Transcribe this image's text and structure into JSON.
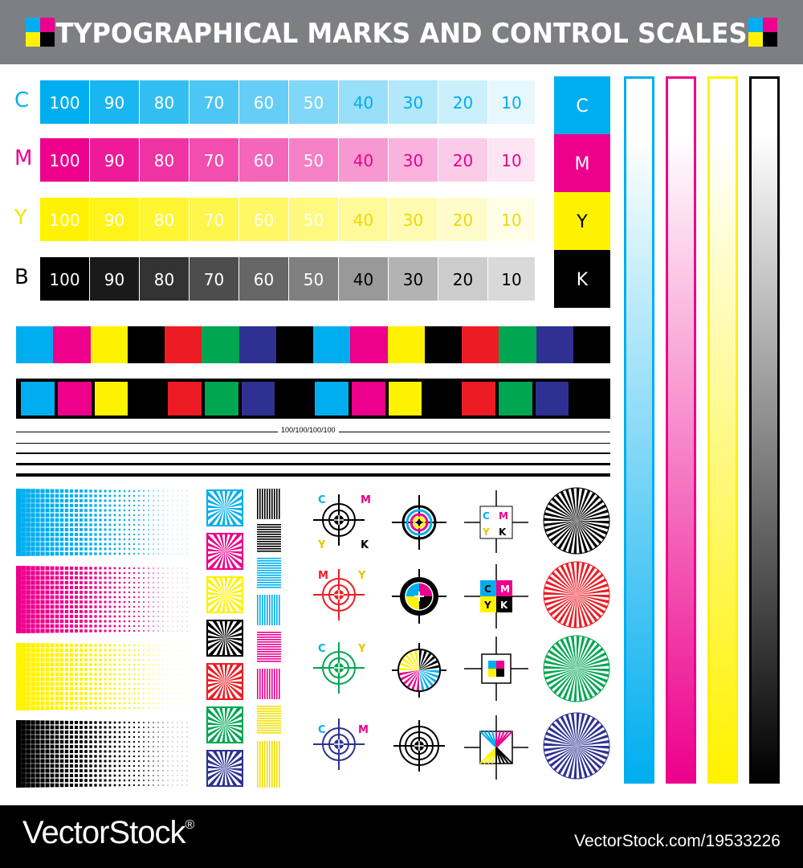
{
  "header": {
    "title": "TYPOGRAPHICAL MARKS AND CONTROL SCALES (CMYK)"
  },
  "colors": {
    "cyan": "#00aeef",
    "magenta": "#ec008c",
    "yellow": "#fff200",
    "black": "#000000",
    "red": "#ed1c24",
    "green": "#00a651",
    "blue": "#2e3192",
    "gray": "#7e7f82"
  },
  "tint_scale": {
    "steps": [
      "100",
      "90",
      "80",
      "70",
      "60",
      "50",
      "40",
      "30",
      "20",
      "10"
    ],
    "rows": [
      {
        "label": "C",
        "color": "cyan"
      },
      {
        "label": "M",
        "color": "magenta"
      },
      {
        "label": "Y",
        "color": "yellow"
      },
      {
        "label": "B",
        "color": "black"
      }
    ]
  },
  "side_swatches": [
    "C",
    "M",
    "Y",
    "K"
  ],
  "bar_sequence": [
    "cyan",
    "magenta",
    "yellow",
    "black",
    "red",
    "green",
    "blue",
    "black",
    "cyan",
    "magenta",
    "yellow",
    "black",
    "red",
    "green",
    "blue",
    "black"
  ],
  "rule_label": "100/100/100/100",
  "registration_letters": {
    "row1": [
      "C",
      "M",
      "Y",
      "K"
    ],
    "row2": [
      "M",
      "Y"
    ],
    "row3": [
      "C",
      "Y"
    ],
    "row4": [
      "C",
      "M"
    ],
    "grid": [
      "C",
      "M",
      "Y",
      "K"
    ]
  },
  "footer": {
    "brand": "VectorStock",
    "brand_mark": "®",
    "id": "VectorStock.com/19533226"
  }
}
